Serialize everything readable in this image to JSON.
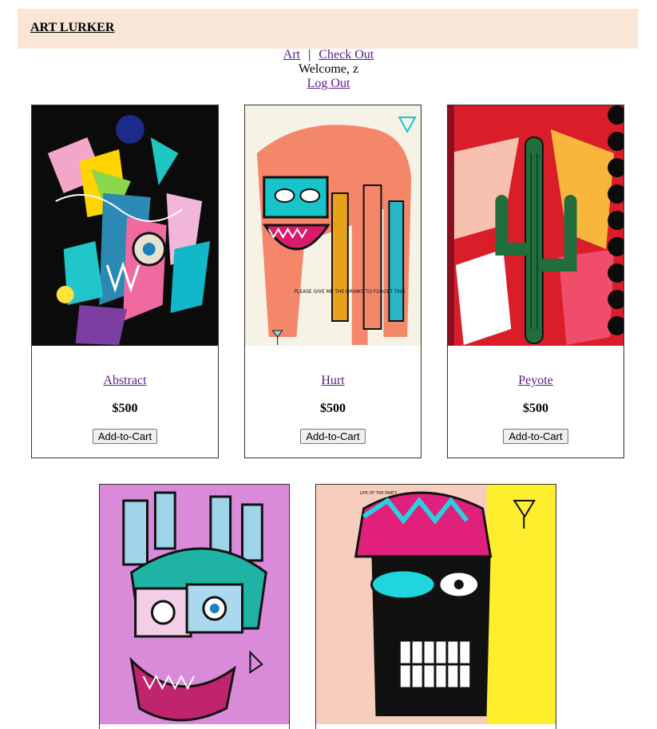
{
  "header": {
    "brand": "ART LURKER"
  },
  "nav": {
    "art_link": "Art",
    "separator": "|",
    "checkout_link": "Check Out",
    "welcome": "Welcome, z",
    "logout_link": "Log Out"
  },
  "products": [
    {
      "title": "Abstract",
      "price": "$500",
      "button": "Add-to-Cart"
    },
    {
      "title": "Hurt",
      "price": "$500",
      "button": "Add-to-Cart"
    },
    {
      "title": "Peyote",
      "price": "$500",
      "button": "Add-to-Cart"
    }
  ],
  "art_text": {
    "hurt_caption": "PLEASE GIVE ME THE DRINKS TO FORGET THIS",
    "party_caption": "LIFE OF THE PARTY"
  },
  "colors": {
    "header_bg": "#f9e6d6",
    "link": "#551a8b"
  }
}
